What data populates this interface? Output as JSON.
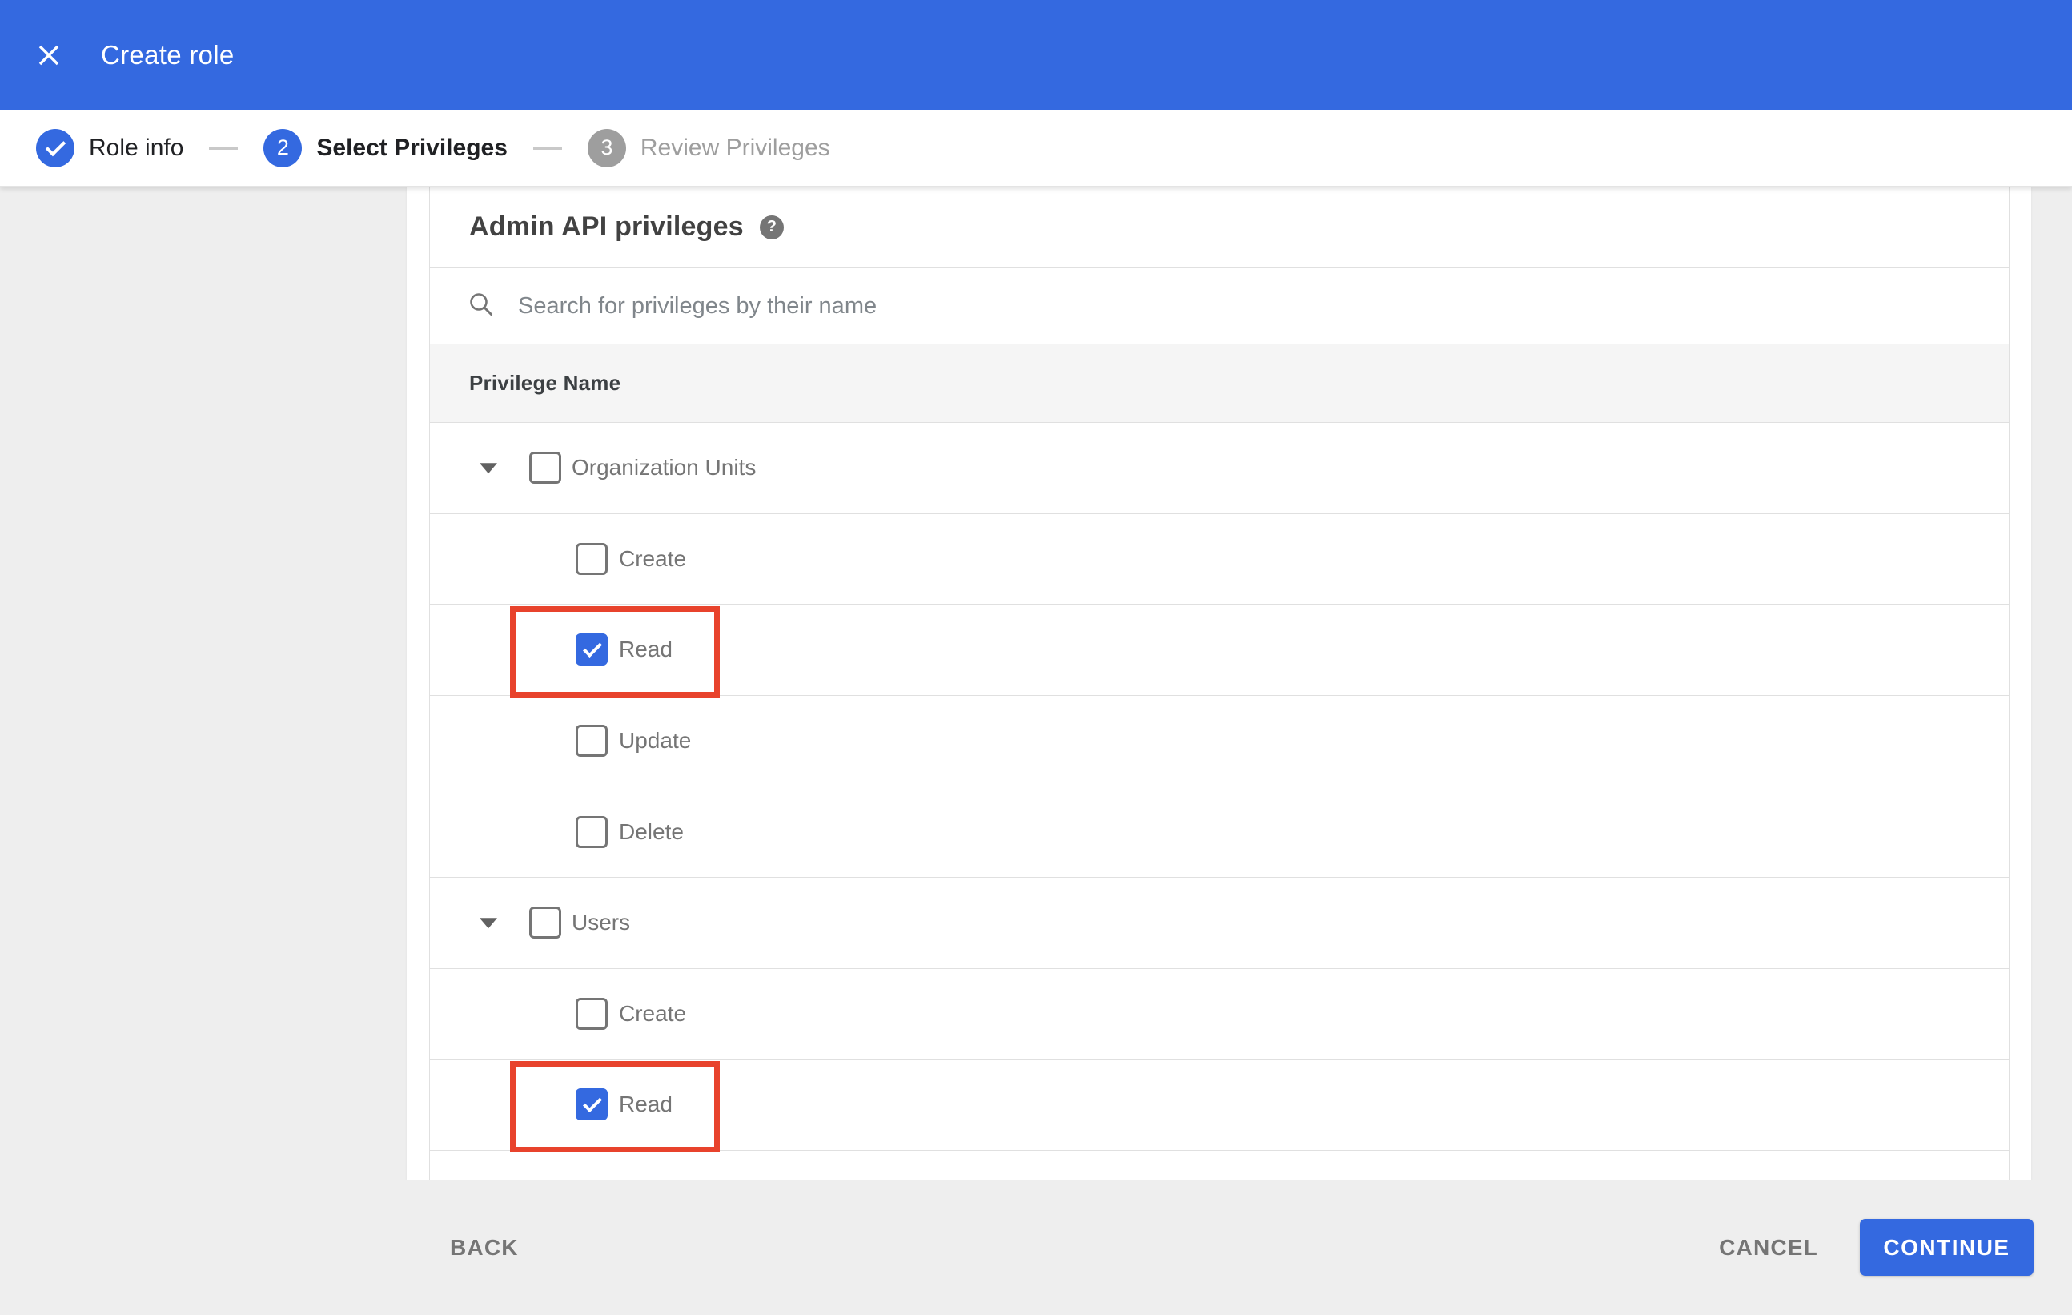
{
  "header": {
    "title": "Create role"
  },
  "stepper": {
    "steps": [
      {
        "number": "1",
        "label": "Role info",
        "state": "done"
      },
      {
        "number": "2",
        "label": "Select Privileges",
        "state": "active"
      },
      {
        "number": "3",
        "label": "Review Privileges",
        "state": "upcoming"
      }
    ]
  },
  "panel": {
    "heading": "Admin API privileges",
    "search": {
      "placeholder": "Search for privileges by their name"
    },
    "table": {
      "column_header": "Privilege Name",
      "rows": [
        {
          "label": "Organization Units",
          "type": "parent",
          "checked": false,
          "expanded": true,
          "highlighted": false
        },
        {
          "label": "Create",
          "type": "child",
          "checked": false,
          "highlighted": false
        },
        {
          "label": "Read",
          "type": "child",
          "checked": true,
          "highlighted": true
        },
        {
          "label": "Update",
          "type": "child",
          "checked": false,
          "highlighted": false
        },
        {
          "label": "Delete",
          "type": "child",
          "checked": false,
          "highlighted": false
        },
        {
          "label": "Users",
          "type": "parent",
          "checked": false,
          "expanded": true,
          "highlighted": false
        },
        {
          "label": "Create",
          "type": "child",
          "checked": false,
          "highlighted": false
        },
        {
          "label": "Read",
          "type": "child",
          "checked": true,
          "highlighted": true
        }
      ]
    }
  },
  "footer": {
    "back_label": "BACK",
    "cancel_label": "CANCEL",
    "continue_label": "CONTINUE"
  },
  "icons": {
    "close": "close-icon",
    "help": "?",
    "search": "search-icon",
    "collapse": "triangle-down"
  },
  "colors": {
    "accent_blue": "#3469e0",
    "highlight_red": "#e8432c",
    "page_background": "#eeeeee",
    "table_header_background": "#f5f5f5",
    "divider": "#e0e0e0"
  }
}
